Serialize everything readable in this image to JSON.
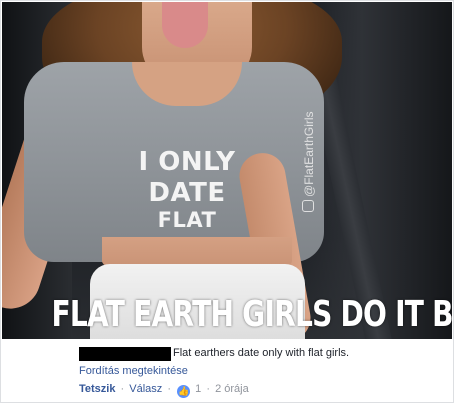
{
  "photo": {
    "shirt_text": [
      "I ONLY",
      "DATE",
      "FLAT EARTHERS"
    ],
    "watermark": "@FlatEarthGirls",
    "caption": "FLAT EARTH GIRLS DO IT BETTER"
  },
  "comment": {
    "text": "Flat earthers date only with flat girls.",
    "translate_link": "Fordítás megtekintése",
    "like_label": "Tetszik",
    "reply_label": "Válasz",
    "separator": "·",
    "like_count": "1",
    "time": "2 órája",
    "like_icon": "thumbs-up-icon"
  },
  "colors": {
    "link": "#365899",
    "meta": "#90949c",
    "like_badge": "#5890ff",
    "text": "#1d2129"
  }
}
